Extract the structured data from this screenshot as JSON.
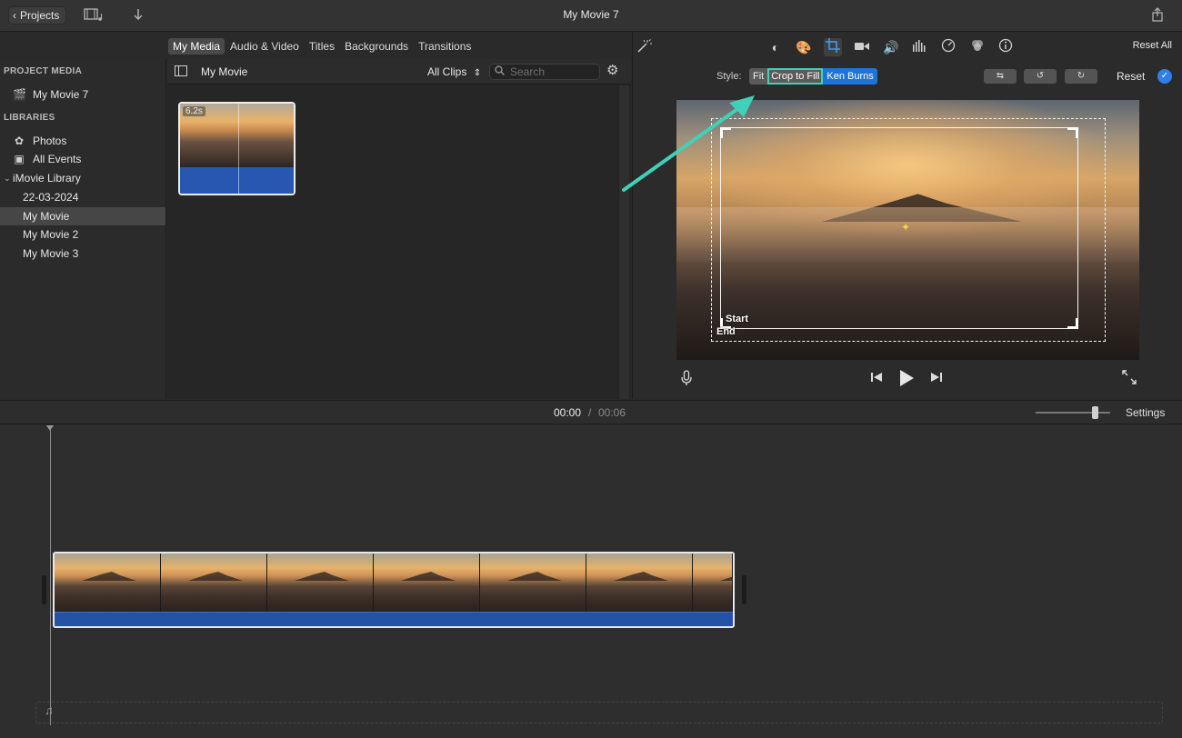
{
  "app": {
    "window_title": "My Movie 7"
  },
  "topbar": {
    "projects_label": "Projects",
    "icons": [
      "film-music-icon",
      "download-arrow-icon",
      "share-icon"
    ]
  },
  "media_tabs": [
    "My Media",
    "Audio & Video",
    "Titles",
    "Backgrounds",
    "Transitions"
  ],
  "sidebar": {
    "project_media_header": "PROJECT MEDIA",
    "project_item": "My Movie 7",
    "libraries_header": "LIBRARIES",
    "photos": "Photos",
    "all_events": "All Events",
    "library": "iMovie Library",
    "events": [
      "22-03-2024",
      "My Movie",
      "My Movie 2",
      "My Movie 3"
    ],
    "selected_event": "My Movie"
  },
  "browser": {
    "title": "My Movie",
    "clips_filter": "All Clips",
    "search_placeholder": "Search",
    "clip_duration": "6.2s"
  },
  "viewer": {
    "reset_all": "Reset All",
    "style_label": "Style:",
    "style_options": [
      "Fit",
      "Crop to Fill",
      "Ken Burns"
    ],
    "active_style": "Ken Burns",
    "reset_label": "Reset",
    "start_label": "Start",
    "end_label": "End",
    "accent_color": "#3fd2b8"
  },
  "timeline": {
    "current_time": "00:00",
    "separator": "/",
    "total_time": "00:06",
    "settings_label": "Settings",
    "zoom_level": 0.75
  }
}
